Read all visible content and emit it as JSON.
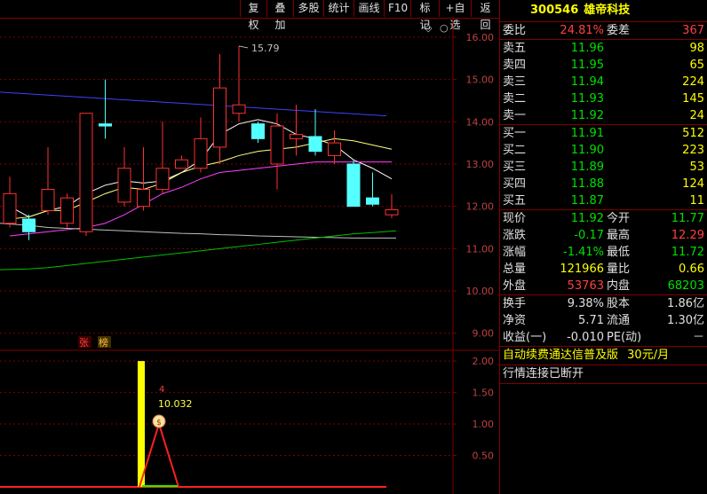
{
  "toolbar": {
    "buttons": [
      "复权",
      "叠加",
      "多股",
      "统计",
      "画线",
      "F10",
      "标记",
      "+自选",
      "返回"
    ]
  },
  "chart_data": {
    "type": "candlestick",
    "yaxis_ticks": [
      "16.00",
      "15.00",
      "14.00",
      "13.00",
      "12.00",
      "11.00",
      "10.00",
      "9.00"
    ],
    "ylim": [
      8.7,
      16.25
    ],
    "candles": [
      {
        "o": 11.6,
        "c": 12.3,
        "h": 12.7,
        "l": 11.5
      },
      {
        "o": 11.7,
        "c": 11.4,
        "h": 11.8,
        "l": 11.2
      },
      {
        "o": 11.9,
        "c": 12.4,
        "h": 13.4,
        "l": 11.8
      },
      {
        "o": 11.6,
        "c": 12.2,
        "h": 12.3,
        "l": 11.5
      },
      {
        "o": 11.4,
        "c": 14.2,
        "h": 14.2,
        "l": 11.3
      },
      {
        "o": 13.95,
        "c": 13.9,
        "h": 15.0,
        "l": 13.6
      },
      {
        "o": 12.1,
        "c": 12.9,
        "h": 13.4,
        "l": 12.0
      },
      {
        "o": 12.0,
        "c": 12.4,
        "h": 13.4,
        "l": 11.9
      },
      {
        "o": 12.4,
        "c": 12.9,
        "h": 14.0,
        "l": 12.3
      },
      {
        "o": 12.9,
        "c": 13.1,
        "h": 13.2,
        "l": 12.9
      },
      {
        "o": 12.9,
        "c": 13.6,
        "h": 14.1,
        "l": 12.8
      },
      {
        "o": 13.4,
        "c": 14.8,
        "h": 15.6,
        "l": 13.0
      },
      {
        "o": 14.2,
        "c": 14.4,
        "h": 15.79,
        "l": 14.0
      },
      {
        "o": 13.95,
        "c": 13.6,
        "h": 14.0,
        "l": 13.5
      },
      {
        "o": 13.0,
        "c": 13.9,
        "h": 14.2,
        "l": 12.4
      },
      {
        "o": 13.6,
        "c": 13.7,
        "h": 14.4,
        "l": 13.2
      },
      {
        "o": 13.65,
        "c": 13.3,
        "h": 14.3,
        "l": 13.2
      },
      {
        "o": 13.2,
        "c": 13.5,
        "h": 13.8,
        "l": 13.0
      },
      {
        "o": 13.0,
        "c": 12.0,
        "h": 13.1,
        "l": 12.0
      },
      {
        "o": 12.2,
        "c": 12.05,
        "h": 12.8,
        "l": 12.0
      },
      {
        "o": 11.8,
        "c": 11.92,
        "h": 12.29,
        "l": 11.72
      }
    ],
    "max_label": "15.79",
    "ma_series": [
      {
        "color": "#ffffff",
        "values": [
          12.0,
          11.75,
          11.9,
          12.0,
          12.3,
          12.5,
          12.6,
          12.55,
          12.6,
          12.8,
          13.1,
          13.7,
          13.95,
          14.05,
          13.95,
          13.7,
          13.6,
          13.45,
          13.1,
          12.9,
          12.65
        ]
      },
      {
        "color": "#ffff80",
        "values": [
          11.7,
          11.75,
          11.9,
          11.9,
          12.1,
          12.3,
          12.45,
          12.4,
          12.55,
          12.8,
          12.95,
          13.05,
          13.2,
          13.3,
          13.35,
          13.4,
          13.5,
          13.6,
          13.55,
          13.45,
          13.35
        ]
      },
      {
        "color": "#ff40ff",
        "values": [
          11.3,
          11.35,
          11.4,
          11.45,
          11.5,
          11.6,
          11.8,
          12.05,
          12.3,
          12.45,
          12.65,
          12.8,
          12.85,
          12.9,
          12.95,
          13.0,
          13.05,
          13.05,
          13.05,
          13.05,
          13.05
        ]
      },
      {
        "color": "#c0c0c0",
        "values": [
          11.6,
          11.55,
          11.5,
          11.48,
          11.46,
          11.44,
          11.42,
          11.4,
          11.38,
          11.36,
          11.35,
          11.33,
          11.32,
          11.3,
          11.29,
          11.28,
          11.27,
          11.26,
          11.25,
          11.25,
          11.25
        ]
      },
      {
        "color": "#00c000",
        "values": [
          10.5,
          10.52,
          10.55,
          10.6,
          10.65,
          10.7,
          10.75,
          10.8,
          10.85,
          10.9,
          10.95,
          11.0,
          11.05,
          11.1,
          11.15,
          11.2,
          11.25,
          11.3,
          11.35,
          11.38,
          11.42
        ]
      },
      {
        "color": "#4040ff",
        "values": [
          14.7,
          14.66,
          14.63,
          14.6,
          14.57,
          14.53,
          14.5,
          14.47,
          14.44,
          14.41,
          14.38,
          14.35,
          14.33,
          14.3,
          14.28,
          14.25,
          14.22,
          14.2,
          14.18,
          14.16,
          14.14
        ]
      }
    ],
    "tag_zhang": "张",
    "tag_bang": "榜",
    "indicator": {
      "yaxis_ticks": [
        "2.00",
        "1.50",
        "1.00",
        "0.50"
      ],
      "ylim": [
        0,
        2.1
      ],
      "bar_value": 2.0,
      "triangle_peak": 1.0,
      "count_label": "4",
      "value_label": "10.032",
      "money_icon_label": "$"
    }
  },
  "panel": {
    "code": "300546",
    "name": "雄帝科技",
    "weibi_label": "委比",
    "weibi_value": "24.81%",
    "weicha_label": "委差",
    "weicha_value": "367",
    "asks": [
      {
        "label": "卖五",
        "price": "11.96",
        "vol": "98"
      },
      {
        "label": "卖四",
        "price": "11.95",
        "vol": "65"
      },
      {
        "label": "卖三",
        "price": "11.94",
        "vol": "224"
      },
      {
        "label": "卖二",
        "price": "11.93",
        "vol": "145"
      },
      {
        "label": "卖一",
        "price": "11.92",
        "vol": "24"
      }
    ],
    "bids": [
      {
        "label": "买一",
        "price": "11.91",
        "vol": "512"
      },
      {
        "label": "买二",
        "price": "11.90",
        "vol": "223"
      },
      {
        "label": "买三",
        "price": "11.89",
        "vol": "53"
      },
      {
        "label": "买四",
        "price": "11.88",
        "vol": "124"
      },
      {
        "label": "买五",
        "price": "11.87",
        "vol": "11"
      }
    ],
    "stats": [
      {
        "l1": "现价",
        "v1": "11.92",
        "c1": "green",
        "l2": "今开",
        "v2": "11.77",
        "c2": "green"
      },
      {
        "l1": "涨跌",
        "v1": "-0.17",
        "c1": "green",
        "l2": "最高",
        "v2": "12.29",
        "c2": "red"
      },
      {
        "l1": "涨幅",
        "v1": "-1.41%",
        "c1": "green",
        "l2": "最低",
        "v2": "11.72",
        "c2": "green"
      },
      {
        "l1": "总量",
        "v1": "121966",
        "c1": "yellow",
        "l2": "量比",
        "v2": "0.66",
        "c2": "yellow"
      },
      {
        "l1": "外盘",
        "v1": "53763",
        "c1": "red",
        "l2": "内盘",
        "v2": "68203",
        "c2": "green"
      }
    ],
    "stats2": [
      {
        "l1": "换手",
        "v1": "9.38%",
        "l2": "股本",
        "v2": "1.86亿"
      },
      {
        "l1": "净资",
        "v1": "5.71",
        "l2": "流通",
        "v2": "1.30亿"
      },
      {
        "l1": "收益(一)",
        "v1": "-0.010",
        "l2": "PE(动)",
        "v2": "－"
      }
    ],
    "notice1": "自动续费通达信普及版",
    "notice1_price": "30元/月",
    "notice2": "行情连接已断开"
  }
}
